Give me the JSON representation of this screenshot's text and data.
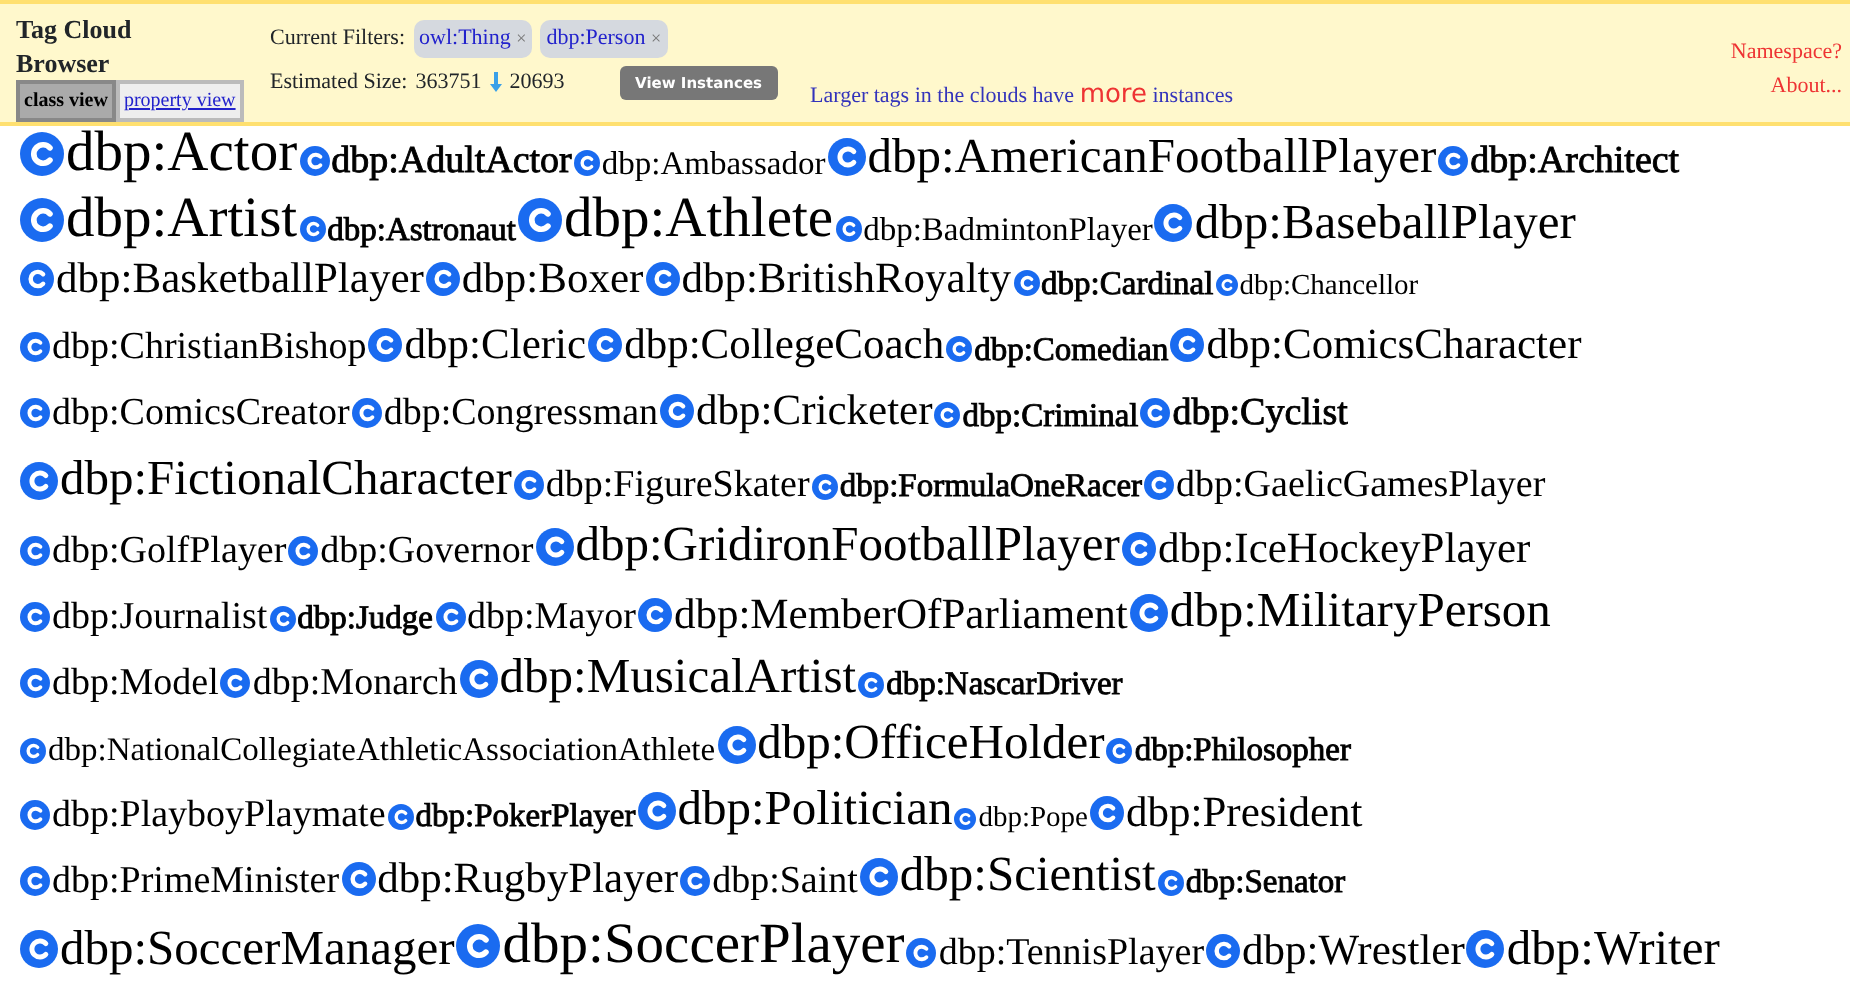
{
  "header": {
    "title": "Tag Cloud Browser",
    "views": [
      {
        "label": "class view",
        "selected": true
      },
      {
        "label": "property view",
        "selected": false
      }
    ],
    "filters_label": "Current Filters:",
    "filters": [
      {
        "label": "owl:Thing",
        "remove": "×"
      },
      {
        "label": "dbp:Person",
        "remove": "×"
      }
    ],
    "size_label": "Estimated Size:",
    "size_from": "363751",
    "size_to": "20693",
    "view_button": "View Instances",
    "legend": {
      "before": "Larger tags in the clouds have",
      "highlight": "more",
      "after": "instances"
    },
    "links": [
      "Namespace?",
      "About..."
    ]
  },
  "tag_rows": [
    [
      {
        "label": "dbp:Actor",
        "bold": false
      },
      {
        "label": "dbp:AdultActor",
        "bold": true
      },
      {
        "label": "dbp:Ambassador",
        "bold": false
      },
      {
        "label": "dbp:AmericanFootballPlayer",
        "bold": false
      },
      {
        "label": "dbp:Architect",
        "bold": true
      }
    ],
    [
      {
        "label": "dbp:Artist",
        "bold": false
      },
      {
        "label": "dbp:Astronaut",
        "bold": true
      },
      {
        "label": "dbp:Athlete",
        "bold": false
      },
      {
        "label": "dbp:BadmintonPlayer",
        "bold": false
      },
      {
        "label": "dbp:BaseballPlayer",
        "bold": false
      }
    ],
    [
      {
        "label": "dbp:BasketballPlayer",
        "bold": false
      },
      {
        "label": "dbp:Boxer",
        "bold": false
      },
      {
        "label": "dbp:BritishRoyalty",
        "bold": false
      },
      {
        "label": "dbp:Cardinal",
        "bold": true
      },
      {
        "label": "dbp:Chancellor",
        "bold": false
      }
    ],
    [
      {
        "label": "dbp:ChristianBishop",
        "bold": false
      },
      {
        "label": "dbp:Cleric",
        "bold": false
      },
      {
        "label": "dbp:CollegeCoach",
        "bold": false
      },
      {
        "label": "dbp:Comedian",
        "bold": true
      },
      {
        "label": "dbp:ComicsCharacter",
        "bold": false
      }
    ],
    [
      {
        "label": "dbp:ComicsCreator",
        "bold": false
      },
      {
        "label": "dbp:Congressman",
        "bold": false
      },
      {
        "label": "dbp:Cricketer",
        "bold": false
      },
      {
        "label": "dbp:Criminal",
        "bold": true
      },
      {
        "label": "dbp:Cyclist",
        "bold": true
      }
    ],
    [
      {
        "label": "dbp:FictionalCharacter",
        "bold": false
      },
      {
        "label": "dbp:FigureSkater",
        "bold": false
      },
      {
        "label": "dbp:FormulaOneRacer",
        "bold": true
      },
      {
        "label": "dbp:GaelicGamesPlayer",
        "bold": false
      }
    ],
    [
      {
        "label": "dbp:GolfPlayer",
        "bold": false
      },
      {
        "label": "dbp:Governor",
        "bold": false
      },
      {
        "label": "dbp:GridironFootballPlayer",
        "bold": false
      },
      {
        "label": "dbp:IceHockeyPlayer",
        "bold": false
      }
    ],
    [
      {
        "label": "dbp:Journalist",
        "bold": false
      },
      {
        "label": "dbp:Judge",
        "bold": true
      },
      {
        "label": "dbp:Mayor",
        "bold": false
      },
      {
        "label": "dbp:MemberOfParliament",
        "bold": false
      },
      {
        "label": "dbp:MilitaryPerson",
        "bold": false
      }
    ],
    [
      {
        "label": "dbp:Model",
        "bold": false
      },
      {
        "label": "dbp:Monarch",
        "bold": false
      },
      {
        "label": "dbp:MusicalArtist",
        "bold": false
      },
      {
        "label": "dbp:NascarDriver",
        "bold": true
      }
    ],
    [
      {
        "label": "dbp:NationalCollegiateAthleticAssociationAthlete",
        "bold": false
      },
      {
        "label": "dbp:OfficeHolder",
        "bold": false
      },
      {
        "label": "dbp:Philosopher",
        "bold": true
      }
    ],
    [
      {
        "label": "dbp:PlayboyPlaymate",
        "bold": false
      },
      {
        "label": "dbp:PokerPlayer",
        "bold": true
      },
      {
        "label": "dbp:Politician",
        "bold": false
      },
      {
        "label": "dbp:Pope",
        "bold": false
      },
      {
        "label": "dbp:President",
        "bold": false
      }
    ],
    [
      {
        "label": "dbp:PrimeMinister",
        "bold": false
      },
      {
        "label": "dbp:RugbyPlayer",
        "bold": false
      },
      {
        "label": "dbp:Saint",
        "bold": false
      },
      {
        "label": "dbp:Scientist",
        "bold": false
      },
      {
        "label": "dbp:Senator",
        "bold": true
      }
    ],
    [
      {
        "label": "dbp:SoccerManager",
        "bold": false
      },
      {
        "label": "dbp:SoccerPlayer",
        "bold": false
      },
      {
        "label": "dbp:TennisPlayer",
        "bold": false
      },
      {
        "label": "dbp:Wrestler",
        "bold": false
      },
      {
        "label": "dbp:Writer",
        "bold": false
      }
    ]
  ]
}
